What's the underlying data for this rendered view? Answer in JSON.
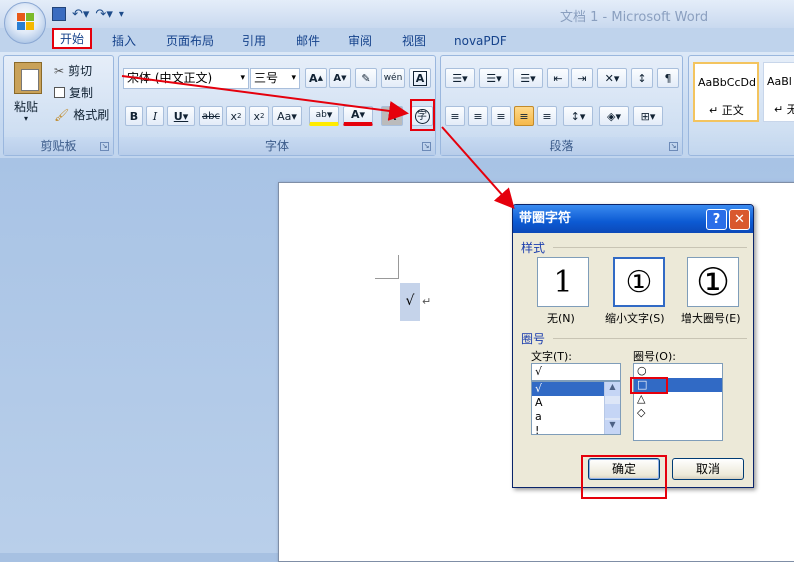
{
  "window": {
    "title": "文档 1 - Microsoft Word"
  },
  "tabs": [
    "开始",
    "插入",
    "页面布局",
    "引用",
    "邮件",
    "审阅",
    "视图",
    "novaPDF"
  ],
  "clipboard": {
    "paste": "粘贴",
    "cut": "剪切",
    "copy": "复制",
    "format_painter": "格式刷",
    "label": "剪贴板"
  },
  "font": {
    "name": "宋体 (中文正文)",
    "size": "三号",
    "label": "字体",
    "wen": "wén",
    "change_case": "Aa",
    "highlight": "ab"
  },
  "paragraph": {
    "label": "段落"
  },
  "styles": {
    "normal_preview": "AaBbCcDd",
    "normal_name": "↵ 正文",
    "nospace_preview": "AaBl",
    "nospace_name": "↵ 无"
  },
  "document": {
    "char": "√",
    "para_mark": "↵"
  },
  "dialog": {
    "title": "带圈字符",
    "style_label": "样式",
    "style_options": [
      {
        "label": "无(N)",
        "glyph": "1"
      },
      {
        "label": "缩小文字(S)",
        "glyph": "①"
      },
      {
        "label": "增大圈号(E)",
        "glyph": "①"
      }
    ],
    "enclosure_label": "圈号",
    "text_label": "文字(T):",
    "text_value": "√",
    "text_list": [
      "√",
      "A",
      "a",
      "!"
    ],
    "shape_label": "圈号(O):",
    "shape_list": [
      "○",
      "□",
      "△",
      "◇"
    ],
    "ok": "确定",
    "cancel": "取消"
  },
  "colors": {
    "accent": "#e5000c",
    "ribbon": "#c4d8f0",
    "dialog_title": "#0c5ad3"
  }
}
